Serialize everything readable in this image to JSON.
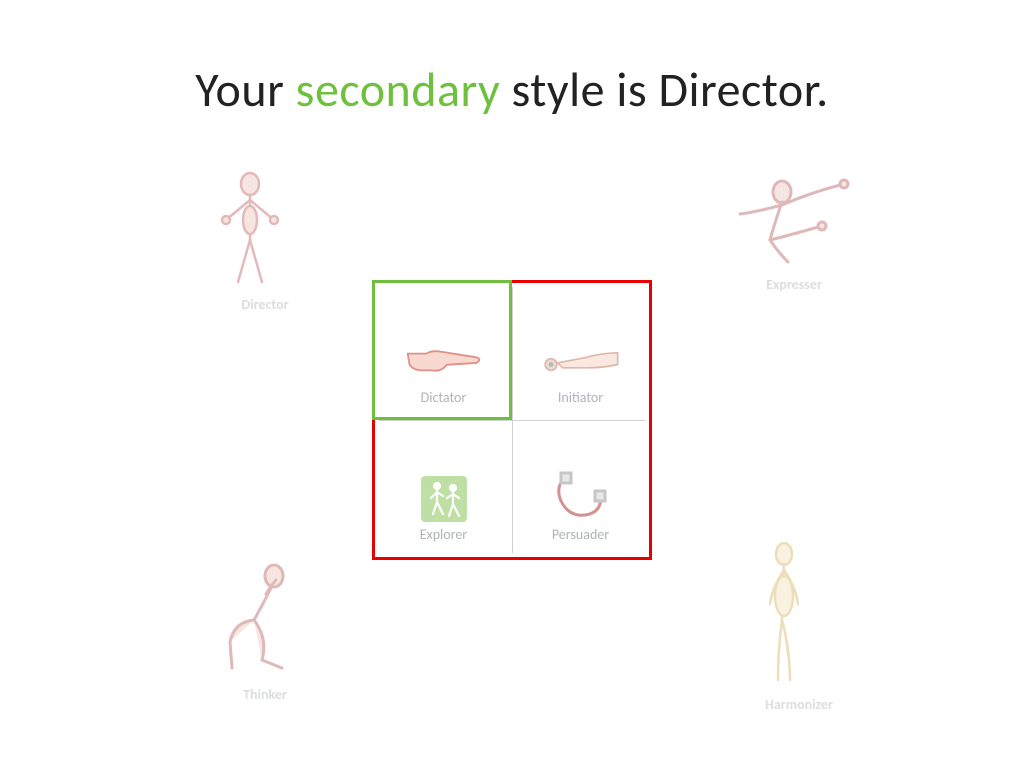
{
  "title": {
    "part1": "Your ",
    "accent": "secondary",
    "part2": " style is Director."
  },
  "colors": {
    "accent_green": "#6fbf3f",
    "accent_red": "#e60000",
    "faded_text": "#9aa0a6"
  },
  "corners": {
    "tl": {
      "label": "Director",
      "icon": "director-figure-icon"
    },
    "tr": {
      "label": "Expresser",
      "icon": "expresser-figure-icon"
    },
    "bl": {
      "label": "Thinker",
      "icon": "thinker-figure-icon"
    },
    "br": {
      "label": "Harmonizer",
      "icon": "harmonizer-figure-icon"
    }
  },
  "grid": {
    "outer_border_color": "red",
    "highlight_quadrant": "tl",
    "highlight_color": "green",
    "quadrants": {
      "tl": {
        "label": "Dictator",
        "icon": "pointing-hand-icon"
      },
      "tr": {
        "label": "Initiator",
        "icon": "pressing-button-hand-icon"
      },
      "bl": {
        "label": "Explorer",
        "icon": "hikers-icon"
      },
      "br": {
        "label": "Persuader",
        "icon": "magnet-icon"
      }
    }
  }
}
